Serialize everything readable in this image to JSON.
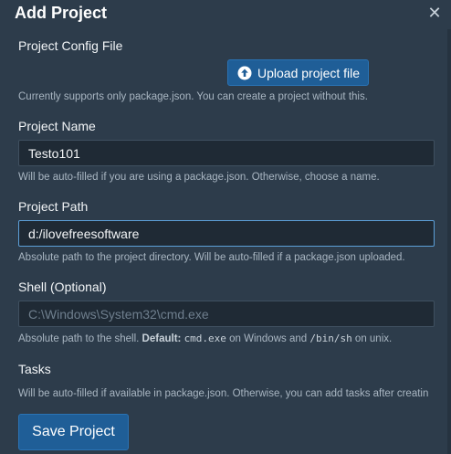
{
  "dialog": {
    "title": "Add Project",
    "close_symbol": "✕"
  },
  "config": {
    "label": "Project Config File",
    "upload_button": "Upload project file",
    "help": "Currently supports only package.json. You can create a project without this."
  },
  "name": {
    "label": "Project Name",
    "value": "Testo101",
    "help": "Will be auto-filled if you are using a package.json. Otherwise, choose a name."
  },
  "path": {
    "label": "Project Path",
    "value": "d:/ilovefreesoftware",
    "help": "Absolute path to the project directory. Will be auto-filled if a package.json uploaded."
  },
  "shell": {
    "label": "Shell (Optional)",
    "placeholder": "C:\\Windows\\System32\\cmd.exe",
    "help_prefix": "Absolute path to the shell.",
    "help_default_label": "Default:",
    "help_windows_value": "cmd.exe",
    "help_mid": "on Windows and",
    "help_unix_value": "/bin/sh",
    "help_suffix": "on unix."
  },
  "tasks": {
    "label": "Tasks",
    "help": "Will be auto-filled if available in package.json. Otherwise, you can add tasks after creatin"
  },
  "footer": {
    "save_button": "Save Project"
  },
  "colors": {
    "background": "#2d3c4b",
    "accent": "#1f5e97",
    "input_bg": "#1f2a35"
  }
}
